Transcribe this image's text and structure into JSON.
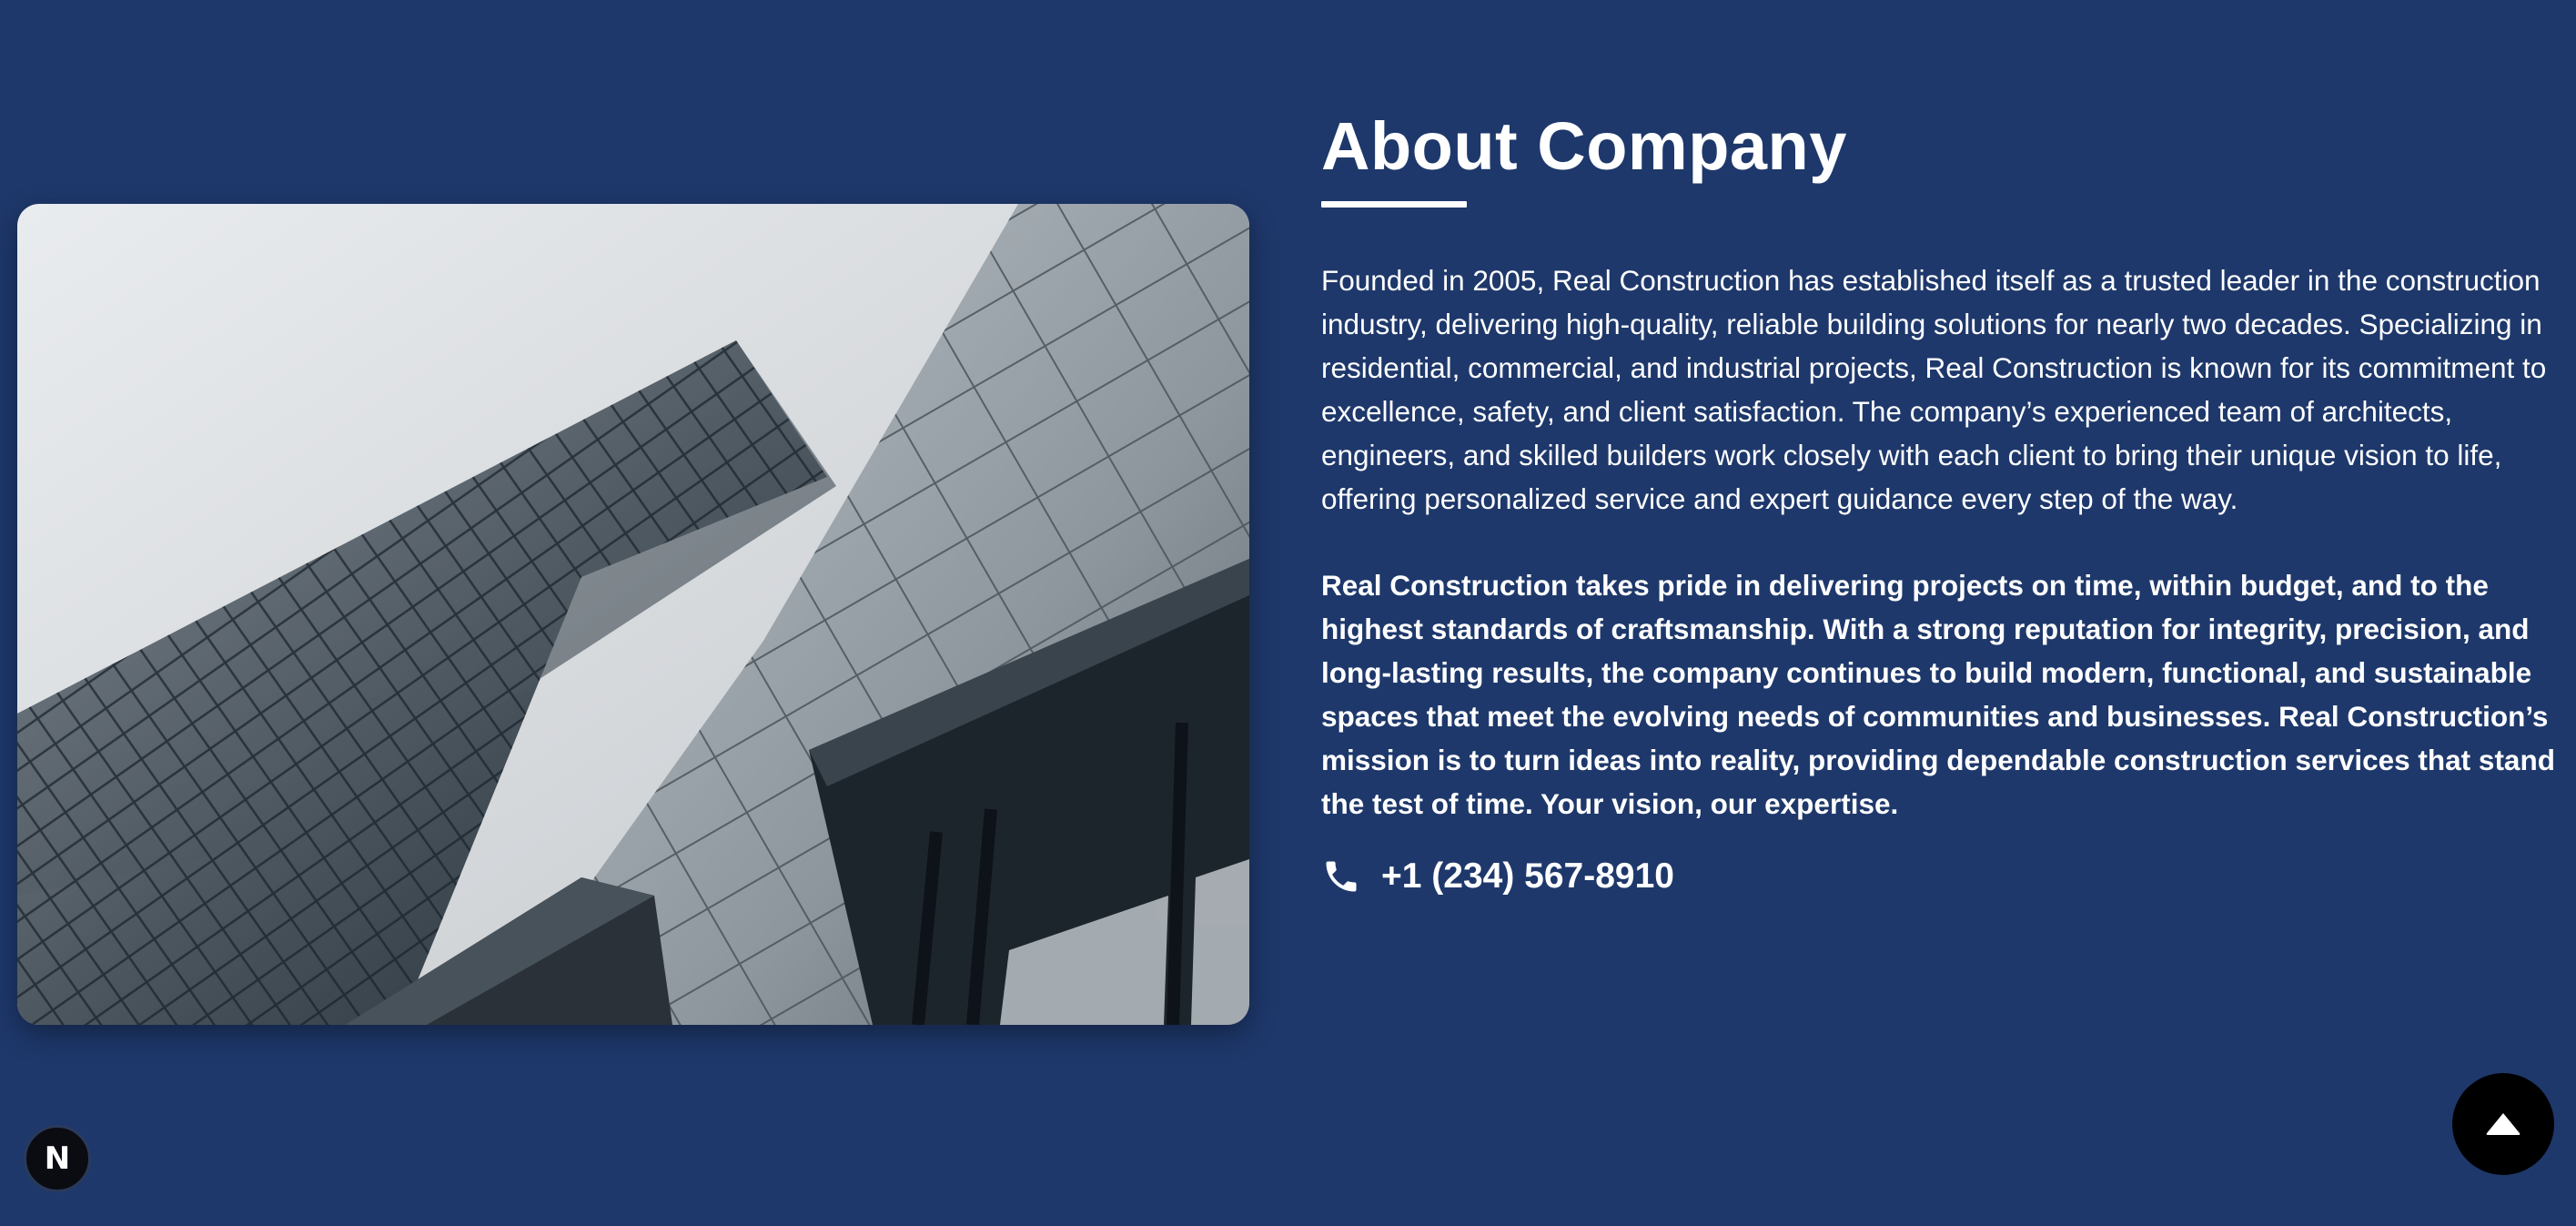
{
  "about": {
    "title": "About Company",
    "paragraph1": "Founded in 2005, Real Construction has established itself as a trusted leader in the construction industry, delivering high-quality, reliable building solutions for nearly two decades. Specializing in residential, commercial, and industrial projects, Real Construction is known for its commitment to excellence, safety, and client satisfaction. The company’s experienced team of architects, engineers, and skilled builders work closely with each client to bring their unique vision to life, offering personalized service and expert guidance every step of the way.",
    "paragraph2": "Real Construction takes pride in delivering projects on time, within budget, and to the highest standards of craftsmanship. With a strong reputation for integrity, precision, and long-lasting results, the company continues to build modern, functional, and sustainable spaces that meet the evolving needs of communities and businesses. Real Construction’s mission is to turn ideas into reality, providing dependable construction services that stand the test of time. Your vision, our expertise.",
    "phone": "+1 (234) 567-8910"
  },
  "icons": {
    "phone": "phone-icon",
    "scroll_top": "caret-up-icon",
    "dev_badge": "N"
  },
  "colors": {
    "background": "#1e386b",
    "text": "#ffffff",
    "scroll_button": "#000000"
  }
}
